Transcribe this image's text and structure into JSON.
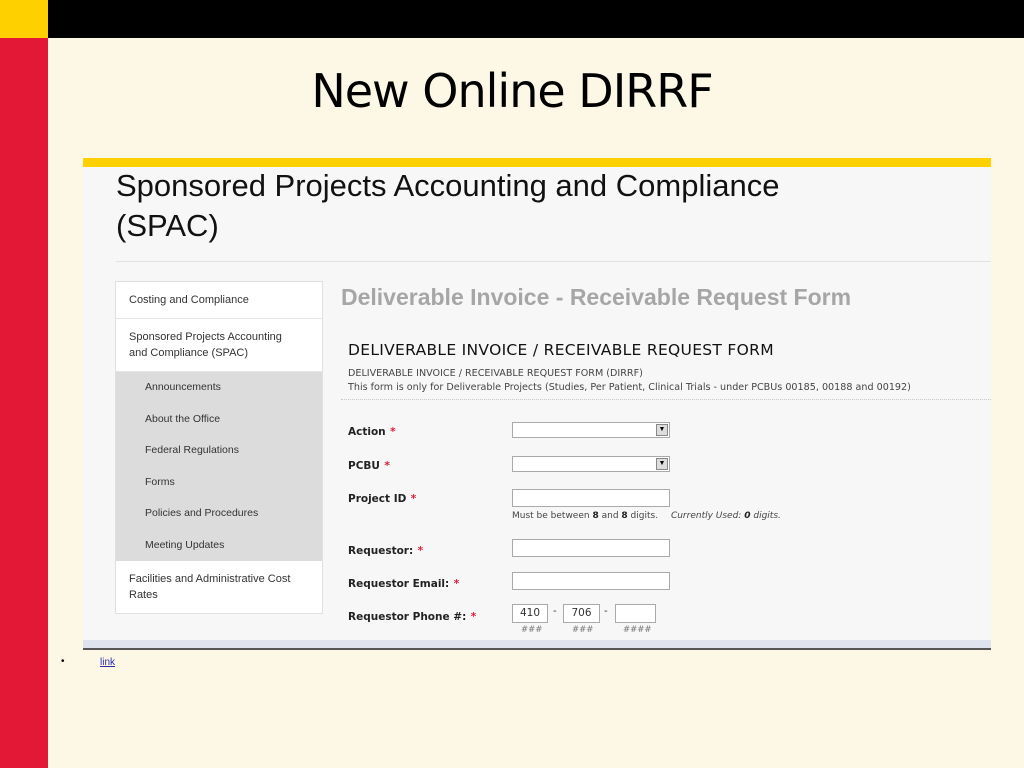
{
  "slide": {
    "title": "New Online DIRRF",
    "bullet": "•",
    "link_label": "link",
    "colors": {
      "accent_yellow": "#ffd000",
      "accent_red": "#e31837",
      "background": "#fdf7e6"
    }
  },
  "site": {
    "title_line1": "Sponsored Projects Accounting and Compliance",
    "title_line2": "(SPAC)"
  },
  "sidebar": {
    "items": [
      {
        "label": "Costing and Compliance"
      },
      {
        "label": "Sponsored Projects Accounting and Compliance (SPAC)"
      }
    ],
    "subitems": [
      {
        "label": "Announcements"
      },
      {
        "label": "About the Office"
      },
      {
        "label": "Federal Regulations"
      },
      {
        "label": "Forms"
      },
      {
        "label": "Policies and Procedures"
      },
      {
        "label": "Meeting Updates"
      }
    ],
    "footer_item": {
      "label": "Facilities and Administrative Cost Rates"
    }
  },
  "main": {
    "page_heading": "Deliverable Invoice - Receivable Request Form",
    "form_heading": "DELIVERABLE INVOICE / RECEIVABLE REQUEST FORM",
    "form_subtitle": "DELIVERABLE INVOICE / RECEIVABLE REQUEST FORM (DIRRF)",
    "form_note": "This form is only for Deliverable Projects (Studies, Per Patient, Clinical Trials - under PCBUs 00185, 00188 and 00192)",
    "required_marker": "*",
    "fields": {
      "action": {
        "label": "Action",
        "value": ""
      },
      "pcbu": {
        "label": "PCBU",
        "value": ""
      },
      "project_id": {
        "label": "Project ID",
        "value": "",
        "hint_prefix": "Must be between",
        "hint_min": "8",
        "hint_and": "and",
        "hint_max": "8",
        "hint_suffix": "digits.",
        "used_prefix": "Currently Used:",
        "used_count": "0",
        "used_suffix": "digits."
      },
      "requestor": {
        "label": "Requestor:",
        "value": ""
      },
      "requestor_email": {
        "label": "Requestor Email:",
        "value": ""
      },
      "requestor_phone": {
        "label": "Requestor Phone #:",
        "area": "410",
        "prefix": "706",
        "line": "",
        "separator": "-",
        "mask_area": "###",
        "mask_prefix": "###",
        "mask_line": "####"
      }
    }
  }
}
